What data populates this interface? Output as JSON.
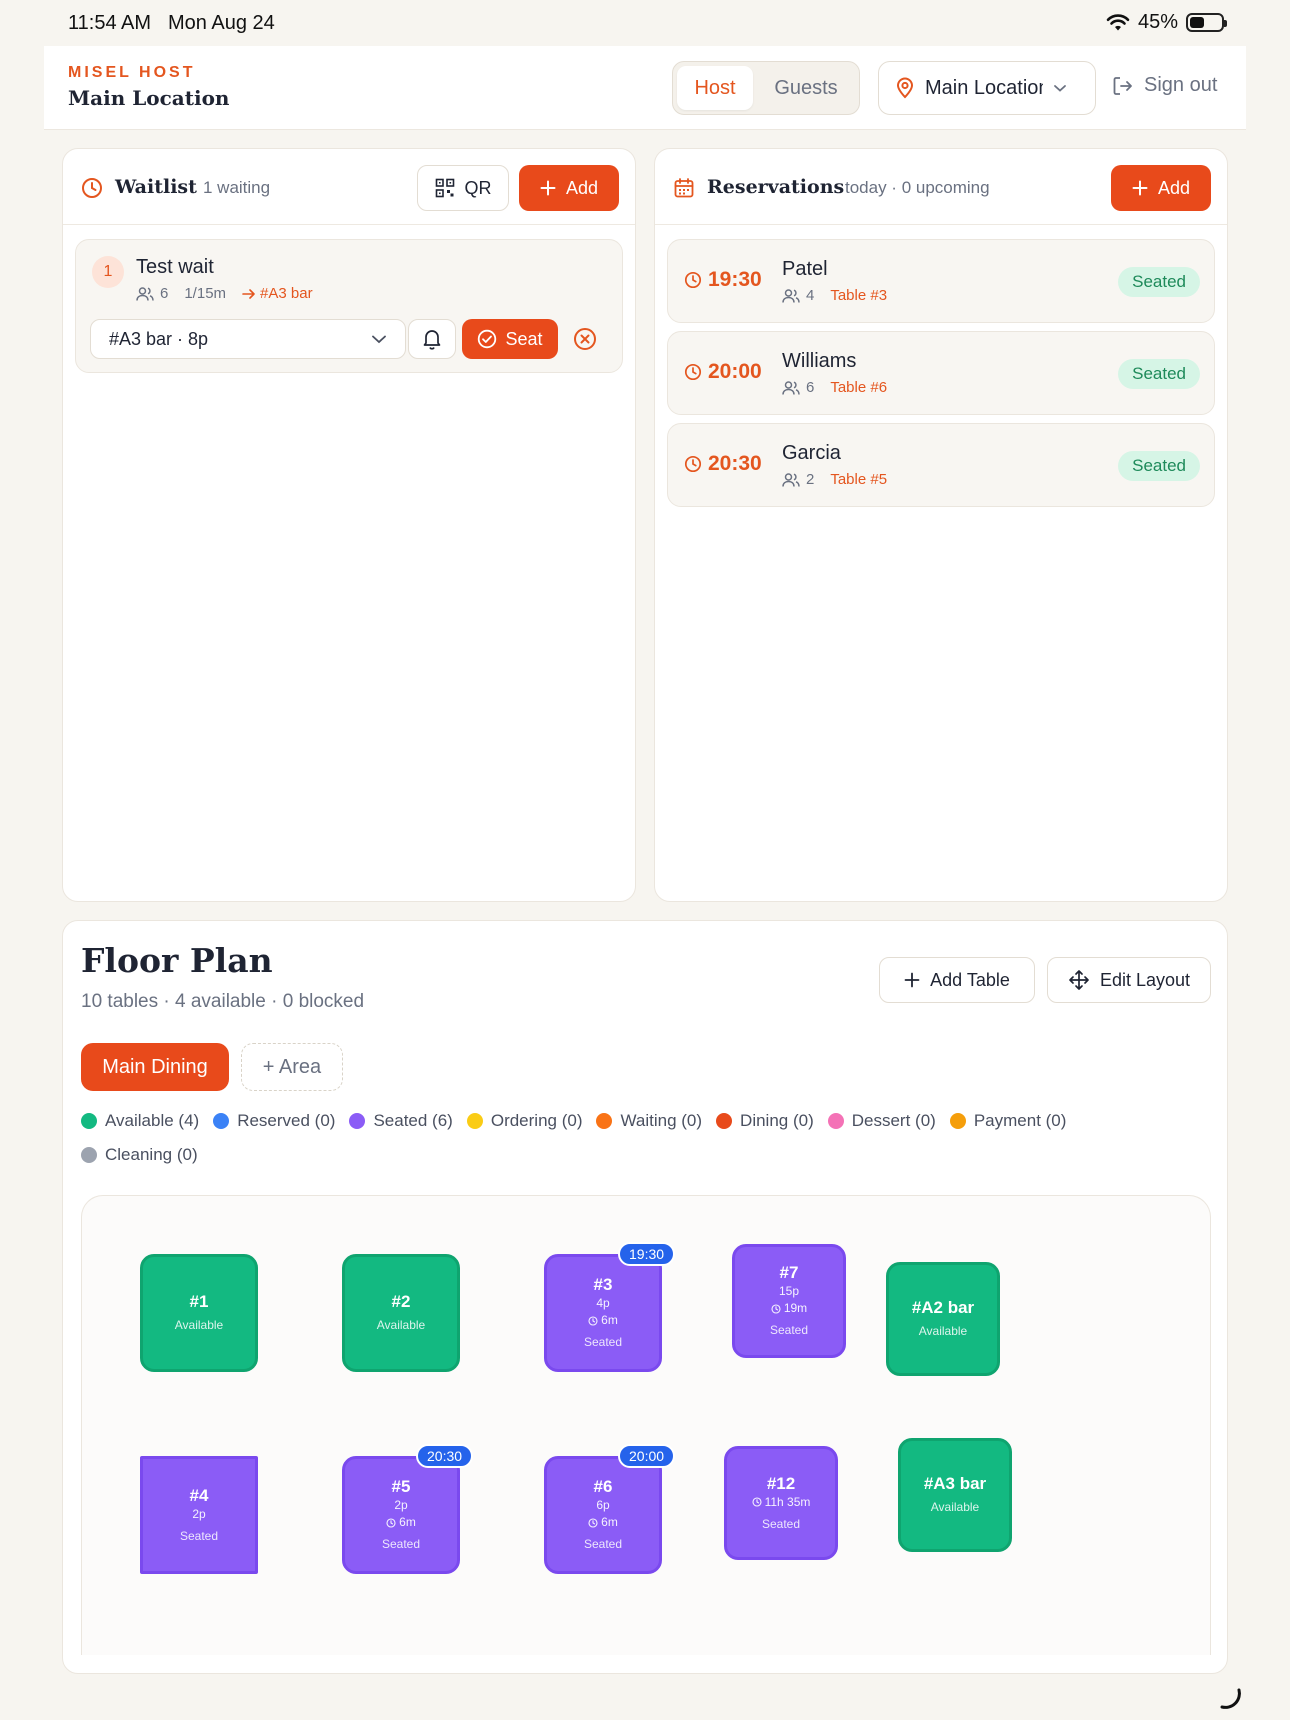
{
  "status_bar": {
    "time": "11:54 AM",
    "date": "Mon Aug 24",
    "battery": "45%"
  },
  "header": {
    "brand": "MISEL HOST",
    "location_name": "Main Location",
    "tabs": [
      {
        "label": "Host",
        "active": true
      },
      {
        "label": "Guests",
        "active": false
      }
    ],
    "location_select": "Main Location",
    "sign_out": "Sign out"
  },
  "waitlist": {
    "title": "Waitlist",
    "count": "1 waiting",
    "qr_label": "QR",
    "add_label": "Add",
    "items": [
      {
        "position": "1",
        "name": "Test wait",
        "party": "6",
        "wait": "1/15m",
        "assigned": "#A3 bar",
        "table_select": "#A3 bar · 8p",
        "seat_label": "Seat"
      }
    ]
  },
  "reservations": {
    "title": "Reservations",
    "summary": "today · 0 upcoming",
    "add_label": "Add",
    "items": [
      {
        "time": "19:30",
        "name": "Patel",
        "party": "4",
        "table": "Table #3",
        "status": "Seated"
      },
      {
        "time": "20:00",
        "name": "Williams",
        "party": "6",
        "table": "Table #6",
        "status": "Seated"
      },
      {
        "time": "20:30",
        "name": "Garcia",
        "party": "2",
        "table": "Table #5",
        "status": "Seated"
      }
    ]
  },
  "floor_plan": {
    "title": "Floor Plan",
    "summary": "10 tables · 4 available · 0 blocked",
    "add_table": "Add Table",
    "edit_layout": "Edit Layout",
    "areas": [
      {
        "label": "Main Dining",
        "active": true
      }
    ],
    "add_area": "+ Area",
    "legend": [
      {
        "label": "Available (4)",
        "color": "#13b981"
      },
      {
        "label": "Reserved (0)",
        "color": "#3b82f6"
      },
      {
        "label": "Seated (6)",
        "color": "#8b5cf6"
      },
      {
        "label": "Ordering (0)",
        "color": "#facc15"
      },
      {
        "label": "Waiting (0)",
        "color": "#f97316"
      },
      {
        "label": "Dining (0)",
        "color": "#e84a1b"
      },
      {
        "label": "Dessert (0)",
        "color": "#f472b6"
      },
      {
        "label": "Payment (0)",
        "color": "#f59e0b"
      },
      {
        "label": "Cleaning (0)",
        "color": "#9ca3af"
      }
    ],
    "tables": [
      {
        "name": "#1",
        "status": "Available",
        "state": "available"
      },
      {
        "name": "#2",
        "status": "Available",
        "state": "available"
      },
      {
        "name": "#3",
        "seats": "4p",
        "elapsed": "6m",
        "status": "Seated",
        "state": "seated",
        "reservation": "19:30"
      },
      {
        "name": "#7",
        "seats": "15p",
        "elapsed": "19m",
        "status": "Seated",
        "state": "seated"
      },
      {
        "name": "#A2 bar",
        "status": "Available",
        "state": "available"
      },
      {
        "name": "#4",
        "seats": "2p",
        "status": "Seated",
        "state": "seated"
      },
      {
        "name": "#5",
        "seats": "2p",
        "elapsed": "6m",
        "status": "Seated",
        "state": "seated",
        "reservation": "20:30"
      },
      {
        "name": "#6",
        "seats": "6p",
        "elapsed": "6m",
        "status": "Seated",
        "state": "seated",
        "reservation": "20:00"
      },
      {
        "name": "#12",
        "elapsed": "11h 35m",
        "status": "Seated",
        "state": "seated"
      },
      {
        "name": "#A3 bar",
        "status": "Available",
        "state": "available"
      }
    ]
  }
}
